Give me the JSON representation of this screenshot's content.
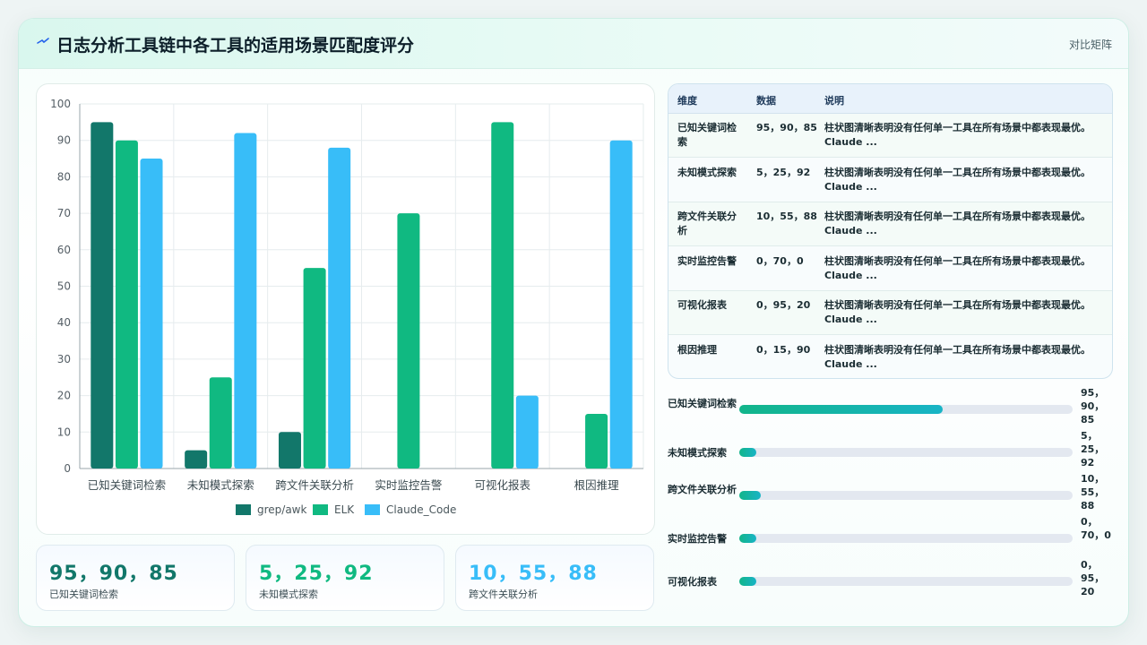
{
  "header": {
    "title": "日志分析工具链中各工具的适用场景匹配度评分",
    "tag": "对比矩阵"
  },
  "colors": {
    "grep_awk": "#12776a",
    "elk": "#10b981",
    "claude_code": "#38bdf8",
    "accent": "#18b4a0"
  },
  "chart_data": {
    "type": "bar",
    "categories": [
      "已知关键词检索",
      "未知模式探索",
      "跨文件关联分析",
      "实时监控告警",
      "可视化报表",
      "根因推理"
    ],
    "series": [
      {
        "name": "grep/awk",
        "values": [
          95,
          5,
          10,
          0,
          0,
          0
        ]
      },
      {
        "name": "ELK",
        "values": [
          90,
          25,
          55,
          70,
          95,
          15
        ]
      },
      {
        "name": "Claude_Code",
        "values": [
          85,
          92,
          88,
          0,
          20,
          90
        ]
      }
    ],
    "ylim": [
      0,
      100
    ],
    "yticks": [
      0,
      10,
      20,
      30,
      40,
      50,
      60,
      70,
      80,
      90,
      100
    ],
    "grid": true,
    "legend": "bottom"
  },
  "kpis": [
    {
      "value": "95，90，85",
      "label": "已知关键词检索",
      "color": "#12776a"
    },
    {
      "value": "5，25，92",
      "label": "未知模式探索",
      "color": "#10b981"
    },
    {
      "value": "10，55，88",
      "label": "跨文件关联分析",
      "color": "#38bdf8"
    }
  ],
  "table": {
    "headers": [
      "维度",
      "数据",
      "说明"
    ],
    "rows": [
      {
        "dim": "已知关键词检索",
        "data": "95，90，85",
        "note": "柱状图清晰表明没有任何单一工具在所有场景中都表现最优。Claude ..."
      },
      {
        "dim": "未知模式探索",
        "data": "5，25，92",
        "note": "柱状图清晰表明没有任何单一工具在所有场景中都表现最优。Claude ..."
      },
      {
        "dim": "跨文件关联分析",
        "data": "10，55，88",
        "note": "柱状图清晰表明没有任何单一工具在所有场景中都表现最优。Claude ..."
      },
      {
        "dim": "实时监控告警",
        "data": "0，70，0",
        "note": "柱状图清晰表明没有任何单一工具在所有场景中都表现最优。Claude ..."
      },
      {
        "dim": "可视化报表",
        "data": "0，95，20",
        "note": "柱状图清晰表明没有任何单一工具在所有场景中都表现最优。Claude ..."
      },
      {
        "dim": "根因推理",
        "data": "0，15，90",
        "note": "柱状图清晰表明没有任何单一工具在所有场景中都表现最优。Claude ..."
      }
    ]
  },
  "progress": [
    {
      "label": "已知关键词检索",
      "value": "95，90，85",
      "fraction": 0.61
    },
    {
      "label": "未知模式探索",
      "value": "5，25，92",
      "fraction": 0.05
    },
    {
      "label": "跨文件关联分析",
      "value": "10，55，88",
      "fraction": 0.065
    },
    {
      "label": "实时监控告警",
      "value": "0，70，0",
      "fraction": 0.05
    },
    {
      "label": "可视化报表",
      "value": "0，95，20",
      "fraction": 0.05
    }
  ]
}
